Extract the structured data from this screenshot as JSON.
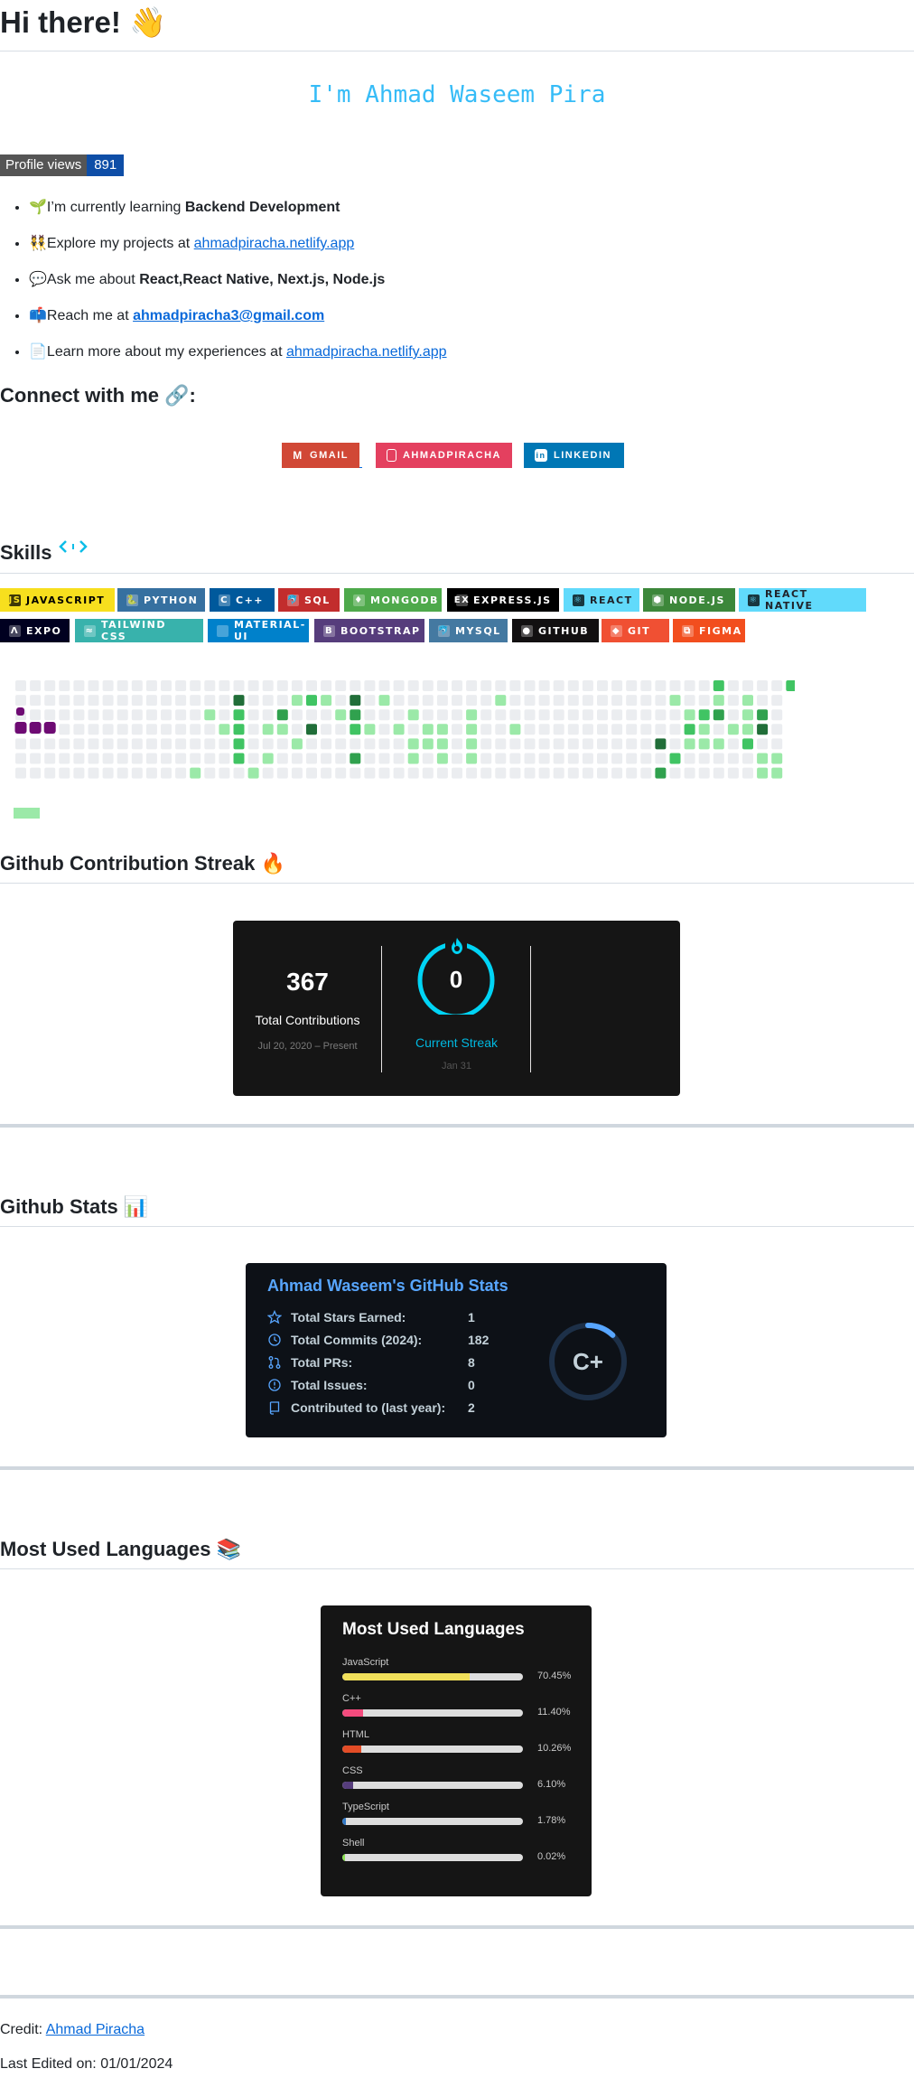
{
  "greeting": {
    "text": "Hi there!",
    "emoji": "👋"
  },
  "typing_text": "I'm Ahmad Waseem Pira",
  "profile_views": {
    "label": "Profile views",
    "count": "891"
  },
  "about": [
    {
      "emoji": "🌱",
      "pre": "I’m currently learning ",
      "bold": "Backend Development",
      "link": ""
    },
    {
      "emoji": "👯",
      "pre": "Explore my projects at ",
      "bold": "",
      "link": "ahmadpiracha.netlify.app"
    },
    {
      "emoji": "💬",
      "pre": "Ask me about ",
      "bold": "React,React Native, Next.js, Node.js",
      "link": ""
    },
    {
      "emoji": "📫",
      "pre": "Reach me at ",
      "bold": "",
      "link": "ahmadpiracha3@gmail.com"
    },
    {
      "emoji": "📄",
      "pre": "Learn more about my experiences at ",
      "bold": "",
      "link": "ahmadpiracha.netlify.app"
    }
  ],
  "connect": {
    "heading": "Connect with me",
    "emoji": "🔗",
    "suffix": ":",
    "badges": [
      {
        "label": "GMAIL",
        "color": "#D14836",
        "icon": "gmail-icon",
        "glyph": "M"
      },
      {
        "label": "AHMADPIRACHA",
        "color": "#E4405F",
        "icon": "instagram-icon",
        "glyph": "◎"
      },
      {
        "label": "LINKEDIN",
        "color": "#0077B5",
        "icon": "linkedin-icon",
        "glyph": "in"
      }
    ]
  },
  "skills": {
    "heading": "Skills",
    "heading_icon": "code-brackets-icon",
    "badges_row1": [
      {
        "label": "JAVASCRIPT",
        "bg": "#F7DF1E",
        "fg": "#000000",
        "icon": "javascript-icon",
        "glyph": "JS"
      },
      {
        "label": "PYTHON",
        "bg": "#3670A0",
        "fg": "#FFFFFF",
        "icon": "python-icon",
        "glyph": "🐍"
      },
      {
        "label": "C++",
        "bg": "#00599C",
        "fg": "#FFFFFF",
        "icon": "cplusplus-icon",
        "glyph": "C"
      },
      {
        "label": "SQL",
        "bg": "#C22D2D",
        "fg": "#FFFFFF",
        "icon": "sql-icon",
        "glyph": "🐬"
      },
      {
        "label": "MONGODB",
        "bg": "#4EA94B",
        "fg": "#FFFFFF",
        "icon": "mongodb-icon",
        "glyph": "♦"
      },
      {
        "label": "EXPRESS.JS",
        "bg": "#000000",
        "fg": "#FFFFFF",
        "icon": "express-icon",
        "glyph": "ex"
      },
      {
        "label": "REACT",
        "bg": "#61DAFB",
        "fg": "#20232A",
        "icon": "react-icon",
        "glyph": "⚛"
      },
      {
        "label": "NODE.JS",
        "bg": "#3C873A",
        "fg": "#FFFFFF",
        "icon": "nodejs-icon",
        "glyph": "⬢"
      },
      {
        "label": "REACT NATIVE",
        "bg": "#61DAFB",
        "fg": "#20232A",
        "icon": "react-native-icon",
        "glyph": "⚛"
      }
    ],
    "badges_row2": [
      {
        "label": "EXPO",
        "bg": "#000020",
        "fg": "#FFFFFF",
        "icon": "expo-icon",
        "glyph": "Λ"
      },
      {
        "label": "TAILWIND CSS",
        "bg": "#38B2AC",
        "fg": "#FFFFFF",
        "icon": "tailwind-icon",
        "glyph": "≈"
      },
      {
        "label": "MATERIAL-UI",
        "bg": "#0081CB",
        "fg": "#FFFFFF",
        "icon": "material-ui-icon",
        "glyph": ""
      },
      {
        "label": "BOOTSTRAP",
        "bg": "#563D7C",
        "fg": "#FFFFFF",
        "icon": "bootstrap-icon",
        "glyph": "B"
      },
      {
        "label": "MYSQL",
        "bg": "#4479A1",
        "fg": "#FFFFFF",
        "icon": "mysql-icon",
        "glyph": "🐬"
      },
      {
        "label": "GITHUB",
        "bg": "#121011",
        "fg": "#FFFFFF",
        "icon": "github-icon",
        "glyph": "●"
      },
      {
        "label": "GIT",
        "bg": "#F05033",
        "fg": "#FFFFFF",
        "icon": "git-icon",
        "glyph": "◆"
      },
      {
        "label": "FIGMA",
        "bg": "#F24E1E",
        "fg": "#FFFFFF",
        "icon": "figma-icon",
        "glyph": "⧉"
      }
    ]
  },
  "contribution_graph": {
    "colors": {
      "empty": "#ebedf0",
      "l1": "#9be9a8",
      "l2": "#40c463",
      "l3": "#30a14e",
      "l4": "#216e39",
      "snake": "#6e0b73"
    },
    "legend_color": "#9be9a8"
  },
  "streak_section": {
    "heading": "Github Contribution Streak",
    "emoji": "🔥",
    "total_value": "367",
    "total_label": "Total Contributions",
    "total_range": "Jul 20, 2020 – Present",
    "current_value": "0",
    "current_label": "Current Streak",
    "current_range": "Jan 31",
    "ring_color": "#00d4f5",
    "fire_icon": "fire-icon"
  },
  "stats_section": {
    "heading": "Github Stats",
    "emoji": "📊",
    "card_title": "Ahmad Waseem's GitHub Stats",
    "rows": [
      {
        "label": "Total Stars Earned:",
        "value": "1",
        "icon": "star-icon"
      },
      {
        "label": "Total Commits (2024):",
        "value": "182",
        "icon": "history-icon"
      },
      {
        "label": "Total PRs:",
        "value": "8",
        "icon": "pull-request-icon"
      },
      {
        "label": "Total Issues:",
        "value": "0",
        "icon": "issue-icon"
      },
      {
        "label": "Contributed to (last year):",
        "value": "2",
        "icon": "repo-icon"
      }
    ],
    "rank": "C+",
    "rank_progress": 0.12,
    "accent": "#58a6ff"
  },
  "languages_section": {
    "heading": "Most Used Languages",
    "emoji": "📚",
    "card_title": "Most Used Languages",
    "langs": [
      {
        "name": "JavaScript",
        "percent": "70.45%",
        "value": 70.45,
        "color": "#f1e05a"
      },
      {
        "name": "C++",
        "percent": "11.40%",
        "value": 11.4,
        "color": "#f34b7d"
      },
      {
        "name": "HTML",
        "percent": "10.26%",
        "value": 10.26,
        "color": "#e34c26"
      },
      {
        "name": "CSS",
        "percent": "6.10%",
        "value": 6.1,
        "color": "#563d7c"
      },
      {
        "name": "TypeScript",
        "percent": "1.78%",
        "value": 1.78,
        "color": "#3178c6"
      },
      {
        "name": "Shell",
        "percent": "0.02%",
        "value": 0.02,
        "color": "#89e051"
      }
    ]
  },
  "footer": {
    "credit_label": "Credit: ",
    "credit_link": "Ahmad Piracha",
    "last_edited": "Last Edited on: 01/01/2024"
  }
}
